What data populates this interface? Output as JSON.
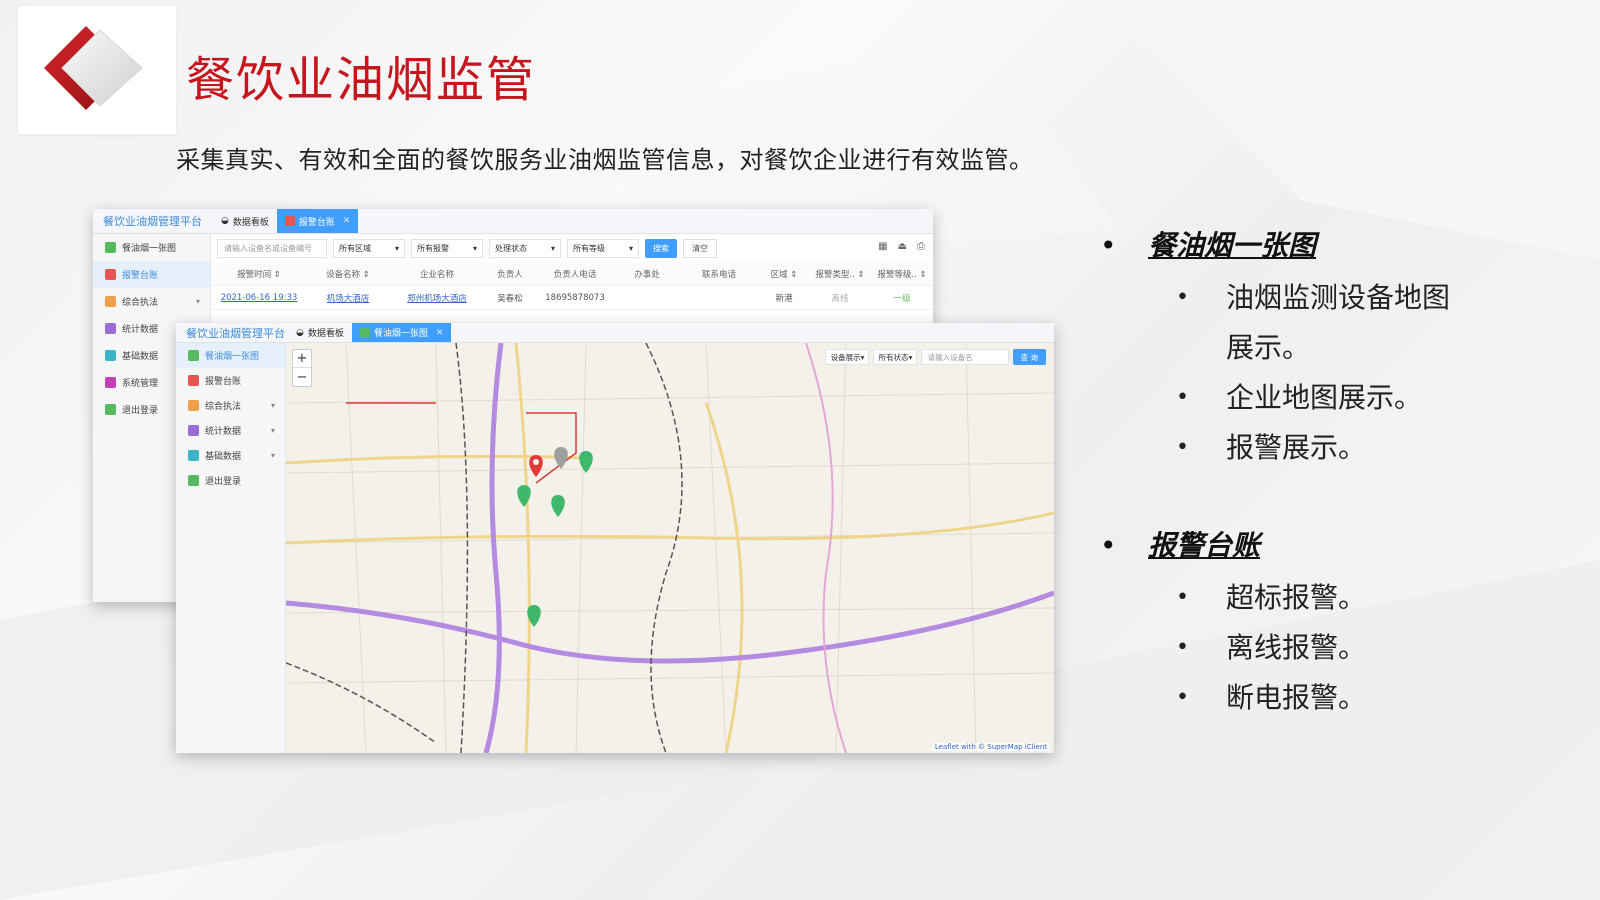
{
  "title": "餐饮业油烟监管",
  "subtitle": "采集真实、有效和全面的餐饮服务业油烟监管信息，对餐饮企业进行有效监管。",
  "colors": {
    "title": "#c4161c",
    "primary": "#409eff",
    "brand": "#3d8bdb"
  },
  "back_window": {
    "brand": "餐饮业油烟管理平台",
    "tabs": [
      {
        "label": "数据看板",
        "icon": "dashboard-icon",
        "active": false
      },
      {
        "label": "报警台账",
        "icon": "alarm-icon",
        "active": true
      }
    ],
    "sidebar": [
      {
        "label": "餐油烟一张图",
        "color": "#56b85f"
      },
      {
        "label": "报警台账",
        "color": "#e6554f",
        "active": true
      },
      {
        "label": "综合执法",
        "color": "#f0a04b",
        "caret": true
      },
      {
        "label": "统计数据",
        "color": "#9b6bd8"
      },
      {
        "label": "基础数据",
        "color": "#3bb3c9"
      },
      {
        "label": "系统管理",
        "color": "#c53fb7"
      },
      {
        "label": "退出登录",
        "color": "#56b85f"
      }
    ],
    "toolbar": {
      "search_placeholder": "请输入设备名或设备编号",
      "selects": [
        "所有区域",
        "所有报警",
        "处理状态",
        "所有等级"
      ],
      "search_btn": "搜索",
      "clear_btn": "清空"
    },
    "table": {
      "headers": [
        "报警时间 ⇕",
        "设备名称 ⇕",
        "企业名称",
        "负责人",
        "负责人电话",
        "办事处",
        "联系电话",
        "区域 ⇕",
        "报警类型.. ⇕",
        "报警等级.. ⇕"
      ],
      "rows": [
        [
          "2021-06-16 19:33",
          "机场大酒店",
          "郑州机场大酒店",
          "吴春松",
          "18695878073",
          "",
          "",
          "新港",
          "离线",
          "一级"
        ]
      ]
    }
  },
  "front_window": {
    "brand": "餐饮业油烟管理平台",
    "tabs": [
      {
        "label": "数据看板",
        "icon": "dashboard-icon",
        "active": false
      },
      {
        "label": "餐油烟一张图",
        "icon": "map-icon",
        "active": true
      }
    ],
    "sidebar": [
      {
        "label": "餐油烟一张图",
        "color": "#56b85f",
        "active": true
      },
      {
        "label": "报警台账",
        "color": "#e6554f"
      },
      {
        "label": "综合执法",
        "color": "#f0a04b",
        "caret": true
      },
      {
        "label": "统计数据",
        "color": "#9b6bd8",
        "caret": true
      },
      {
        "label": "基础数据",
        "color": "#3bb3c9",
        "caret": true
      },
      {
        "label": "退出登录",
        "color": "#56b85f"
      }
    ],
    "map": {
      "zoom_in": "+",
      "zoom_out": "−",
      "device_select": "设备展示",
      "status_select": "所有状态",
      "search_placeholder": "请输入设备名",
      "search_btn": "查 询",
      "attribution": "Leaflet with © SuperMap iClient"
    }
  },
  "bullets": [
    {
      "title": "餐油烟一张图",
      "items": [
        "油烟监测设备地图",
        "展示。",
        "企业地图展示。",
        "报警展示。"
      ]
    },
    {
      "title": "报警台账",
      "items": [
        "超标报警。",
        "离线报警。",
        "断电报警。"
      ]
    }
  ]
}
